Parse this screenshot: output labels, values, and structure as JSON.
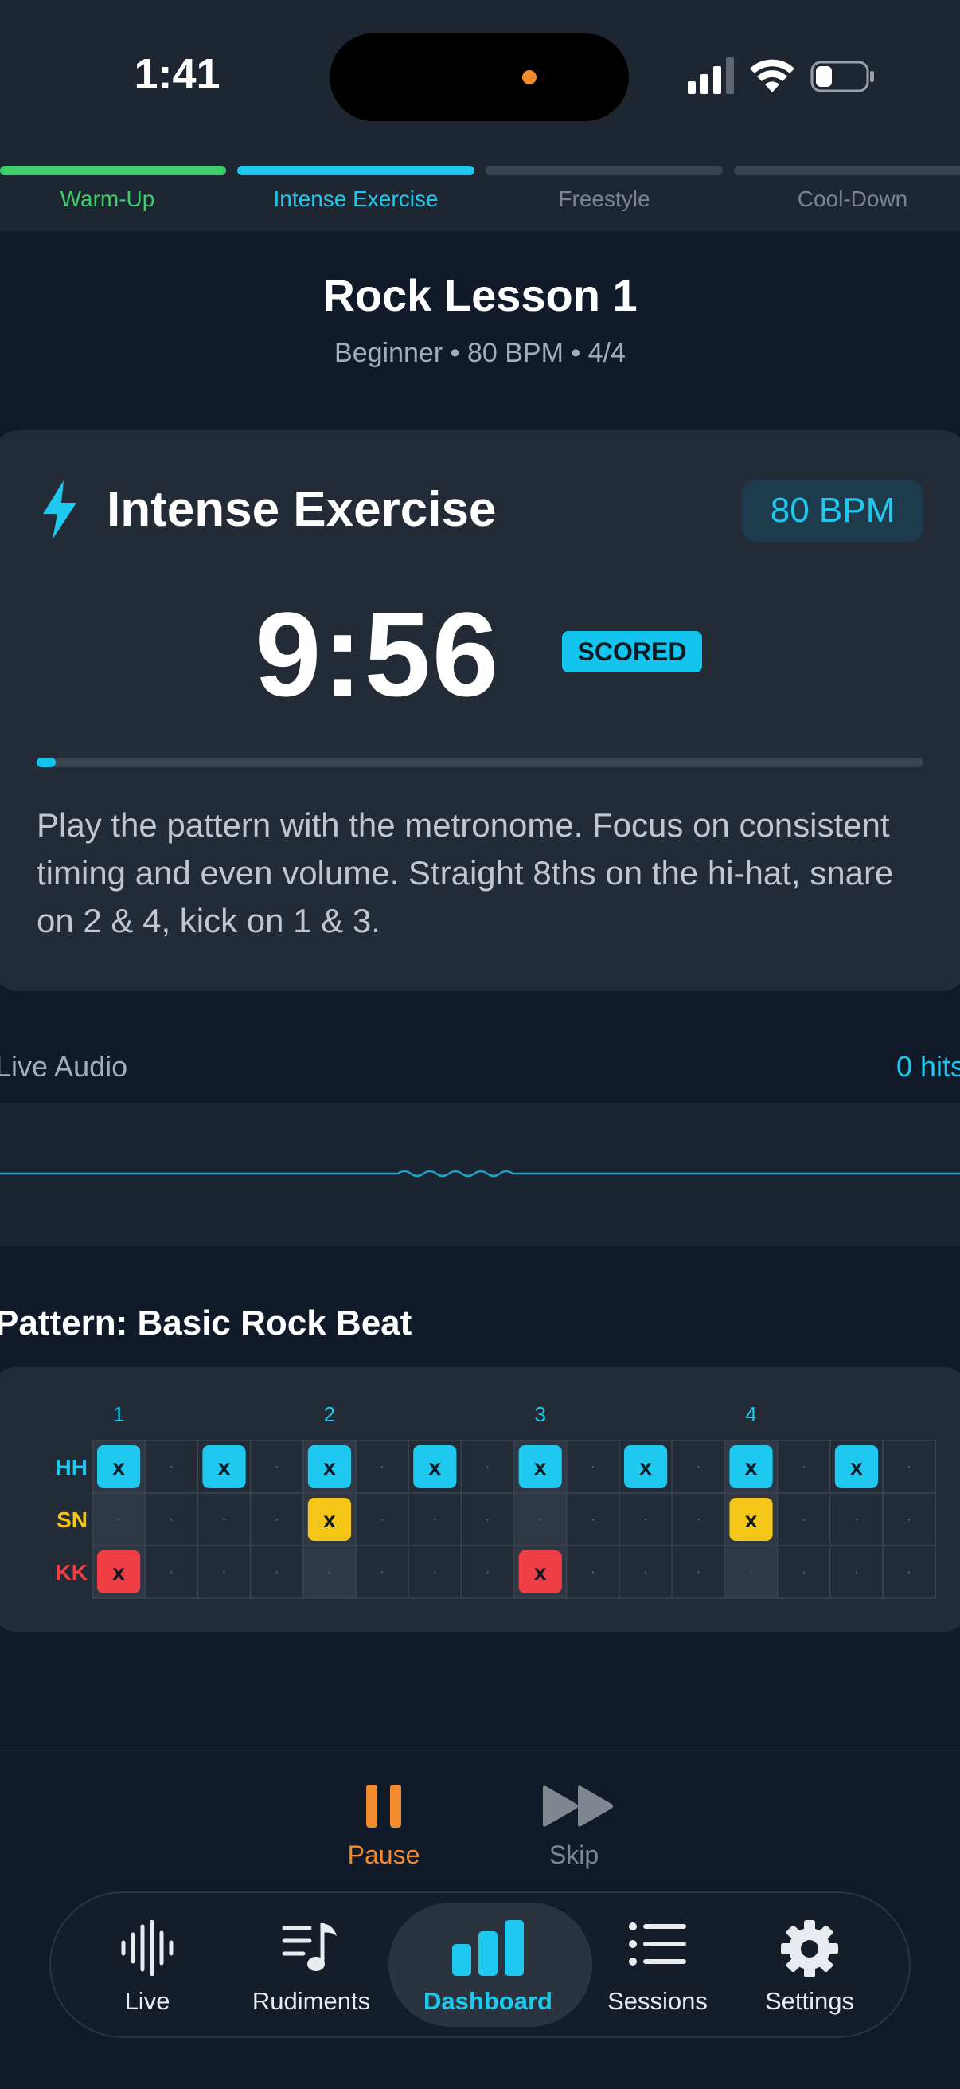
{
  "status_bar": {
    "time": "1:41",
    "icons": [
      "cellular-signal-icon",
      "wifi-icon",
      "battery-icon"
    ]
  },
  "phases": [
    {
      "label": "Warm-Up",
      "state": "done",
      "color": "#3ccf6a"
    },
    {
      "label": "Intense Exercise",
      "state": "active",
      "color": "#1ec8ef"
    },
    {
      "label": "Freestyle",
      "state": "pending",
      "color": "#3a4350"
    },
    {
      "label": "Cool-Down",
      "state": "pending",
      "color": "#3a4350"
    }
  ],
  "lesson": {
    "title": "Rock Lesson 1",
    "subtitle": "Beginner • 80 BPM • 4/4"
  },
  "exercise": {
    "icon": "bolt-icon",
    "title": "Intense Exercise",
    "bpm_badge": "80 BPM",
    "timer": "9:56",
    "scored_badge": "SCORED",
    "progress": 0.02,
    "description": "Play the pattern with the metronome. Focus on consistent timing and even volume. Straight 8ths on the hi-hat, snare on 2 & 4, kick on 1 & 3."
  },
  "live_audio": {
    "label": "Live Audio",
    "hits": "0 hits"
  },
  "pattern": {
    "title": "Pattern: Basic Rock Beat",
    "beat_labels": [
      "1",
      "2",
      "3",
      "4"
    ],
    "steps": 16,
    "rows": [
      {
        "label": "HH",
        "color": "#1ec8ef",
        "hits": [
          0,
          2,
          4,
          6,
          8,
          10,
          12,
          14
        ]
      },
      {
        "label": "SN",
        "color": "#f5c518",
        "hits": [
          4,
          12
        ]
      },
      {
        "label": "KK",
        "color": "#ef3f45",
        "hits": [
          0,
          8
        ]
      }
    ],
    "hit_mark": "x",
    "empty_mark": "·"
  },
  "transport": {
    "pause_label": "Pause",
    "skip_label": "Skip",
    "accent": "#f28a2e"
  },
  "tabs": [
    {
      "label": "Live",
      "icon": "waveform-icon",
      "active": false
    },
    {
      "label": "Rudiments",
      "icon": "music-list-icon",
      "active": false
    },
    {
      "label": "Dashboard",
      "icon": "bar-chart-icon",
      "active": true
    },
    {
      "label": "Sessions",
      "icon": "list-icon",
      "active": false
    },
    {
      "label": "Settings",
      "icon": "gear-icon",
      "active": false
    }
  ]
}
